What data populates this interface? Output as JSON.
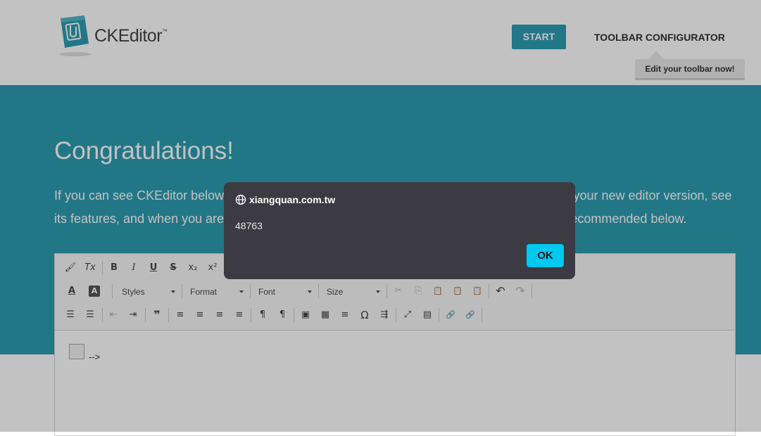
{
  "header": {
    "logo_text": "CKEditor",
    "logo_tm": "™",
    "nav": {
      "start": "START",
      "toolbar_configurator": "TOOLBAR CONFIGURATOR"
    },
    "tooltip": "Edit your toolbar now!"
  },
  "hero": {
    "title": "Congratulations!",
    "paragraph": "If you can see CKEditor below, it means that the installation succeeded. You can now try out your new editor version, see its features, and when you are ready to move on, check some of the most useful resources recommended below."
  },
  "toolbar": {
    "combos": {
      "styles": "Styles",
      "format": "Format",
      "font": "Font",
      "size": "Size"
    },
    "buttons": {
      "copy_formatting": "🖌",
      "remove_format": "Tx",
      "bold": "B",
      "italic": "I",
      "underline": "U",
      "strike": "S",
      "subscript": "x₂",
      "superscript": "x²",
      "text_color": "A",
      "bg_color": "A",
      "cut": "✂",
      "copy": "⎘",
      "paste": "📋",
      "paste_text": "📋",
      "paste_word": "📋",
      "undo": "↶",
      "redo": "↷",
      "numbered_list": "☰",
      "bulleted_list": "☰",
      "outdent": "⇤",
      "indent": "⇥",
      "blockquote": "❞",
      "align_left": "≡",
      "align_center": "≡",
      "align_right": "≡",
      "justify": "≡",
      "bidi_ltr": "¶",
      "bidi_rtl": "¶",
      "image": "▣",
      "table": "▦",
      "horizontal_rule": "≡",
      "special_char": "Ω",
      "page_break": "⇶",
      "maximize": "⤢",
      "show_blocks": "▤",
      "link": "🔗",
      "unlink": "🔗"
    }
  },
  "editor_content": {
    "trailing_text": "-->"
  },
  "dialog": {
    "origin": "xiangquan.com.tw",
    "message": "48763",
    "ok_label": "OK"
  },
  "colors": {
    "brand_teal": "#2d9db2",
    "dialog_bg": "#3c3a42",
    "ok_button": "#00c8ee"
  },
  "icons": [
    "globe-icon",
    "ckeditor-logo-icon"
  ]
}
